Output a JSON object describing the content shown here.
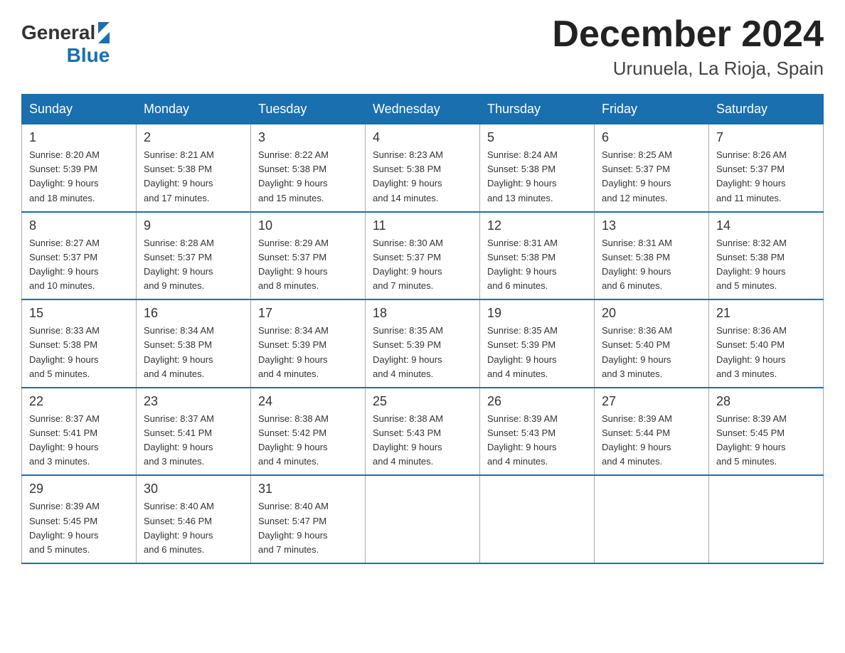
{
  "logo": {
    "general": "General",
    "blue": "Blue"
  },
  "header": {
    "month_year": "December 2024",
    "location": "Urunuela, La Rioja, Spain"
  },
  "weekdays": [
    "Sunday",
    "Monday",
    "Tuesday",
    "Wednesday",
    "Thursday",
    "Friday",
    "Saturday"
  ],
  "weeks": [
    [
      {
        "day": "1",
        "sunrise": "8:20 AM",
        "sunset": "5:39 PM",
        "daylight": "9 hours and 18 minutes."
      },
      {
        "day": "2",
        "sunrise": "8:21 AM",
        "sunset": "5:38 PM",
        "daylight": "9 hours and 17 minutes."
      },
      {
        "day": "3",
        "sunrise": "8:22 AM",
        "sunset": "5:38 PM",
        "daylight": "9 hours and 15 minutes."
      },
      {
        "day": "4",
        "sunrise": "8:23 AM",
        "sunset": "5:38 PM",
        "daylight": "9 hours and 14 minutes."
      },
      {
        "day": "5",
        "sunrise": "8:24 AM",
        "sunset": "5:38 PM",
        "daylight": "9 hours and 13 minutes."
      },
      {
        "day": "6",
        "sunrise": "8:25 AM",
        "sunset": "5:37 PM",
        "daylight": "9 hours and 12 minutes."
      },
      {
        "day": "7",
        "sunrise": "8:26 AM",
        "sunset": "5:37 PM",
        "daylight": "9 hours and 11 minutes."
      }
    ],
    [
      {
        "day": "8",
        "sunrise": "8:27 AM",
        "sunset": "5:37 PM",
        "daylight": "9 hours and 10 minutes."
      },
      {
        "day": "9",
        "sunrise": "8:28 AM",
        "sunset": "5:37 PM",
        "daylight": "9 hours and 9 minutes."
      },
      {
        "day": "10",
        "sunrise": "8:29 AM",
        "sunset": "5:37 PM",
        "daylight": "9 hours and 8 minutes."
      },
      {
        "day": "11",
        "sunrise": "8:30 AM",
        "sunset": "5:37 PM",
        "daylight": "9 hours and 7 minutes."
      },
      {
        "day": "12",
        "sunrise": "8:31 AM",
        "sunset": "5:38 PM",
        "daylight": "9 hours and 6 minutes."
      },
      {
        "day": "13",
        "sunrise": "8:31 AM",
        "sunset": "5:38 PM",
        "daylight": "9 hours and 6 minutes."
      },
      {
        "day": "14",
        "sunrise": "8:32 AM",
        "sunset": "5:38 PM",
        "daylight": "9 hours and 5 minutes."
      }
    ],
    [
      {
        "day": "15",
        "sunrise": "8:33 AM",
        "sunset": "5:38 PM",
        "daylight": "9 hours and 5 minutes."
      },
      {
        "day": "16",
        "sunrise": "8:34 AM",
        "sunset": "5:38 PM",
        "daylight": "9 hours and 4 minutes."
      },
      {
        "day": "17",
        "sunrise": "8:34 AM",
        "sunset": "5:39 PM",
        "daylight": "9 hours and 4 minutes."
      },
      {
        "day": "18",
        "sunrise": "8:35 AM",
        "sunset": "5:39 PM",
        "daylight": "9 hours and 4 minutes."
      },
      {
        "day": "19",
        "sunrise": "8:35 AM",
        "sunset": "5:39 PM",
        "daylight": "9 hours and 4 minutes."
      },
      {
        "day": "20",
        "sunrise": "8:36 AM",
        "sunset": "5:40 PM",
        "daylight": "9 hours and 3 minutes."
      },
      {
        "day": "21",
        "sunrise": "8:36 AM",
        "sunset": "5:40 PM",
        "daylight": "9 hours and 3 minutes."
      }
    ],
    [
      {
        "day": "22",
        "sunrise": "8:37 AM",
        "sunset": "5:41 PM",
        "daylight": "9 hours and 3 minutes."
      },
      {
        "day": "23",
        "sunrise": "8:37 AM",
        "sunset": "5:41 PM",
        "daylight": "9 hours and 3 minutes."
      },
      {
        "day": "24",
        "sunrise": "8:38 AM",
        "sunset": "5:42 PM",
        "daylight": "9 hours and 4 minutes."
      },
      {
        "day": "25",
        "sunrise": "8:38 AM",
        "sunset": "5:43 PM",
        "daylight": "9 hours and 4 minutes."
      },
      {
        "day": "26",
        "sunrise": "8:39 AM",
        "sunset": "5:43 PM",
        "daylight": "9 hours and 4 minutes."
      },
      {
        "day": "27",
        "sunrise": "8:39 AM",
        "sunset": "5:44 PM",
        "daylight": "9 hours and 4 minutes."
      },
      {
        "day": "28",
        "sunrise": "8:39 AM",
        "sunset": "5:45 PM",
        "daylight": "9 hours and 5 minutes."
      }
    ],
    [
      {
        "day": "29",
        "sunrise": "8:39 AM",
        "sunset": "5:45 PM",
        "daylight": "9 hours and 5 minutes."
      },
      {
        "day": "30",
        "sunrise": "8:40 AM",
        "sunset": "5:46 PM",
        "daylight": "9 hours and 6 minutes."
      },
      {
        "day": "31",
        "sunrise": "8:40 AM",
        "sunset": "5:47 PM",
        "daylight": "9 hours and 7 minutes."
      },
      null,
      null,
      null,
      null
    ]
  ],
  "labels": {
    "sunrise": "Sunrise:",
    "sunset": "Sunset:",
    "daylight": "Daylight:"
  }
}
